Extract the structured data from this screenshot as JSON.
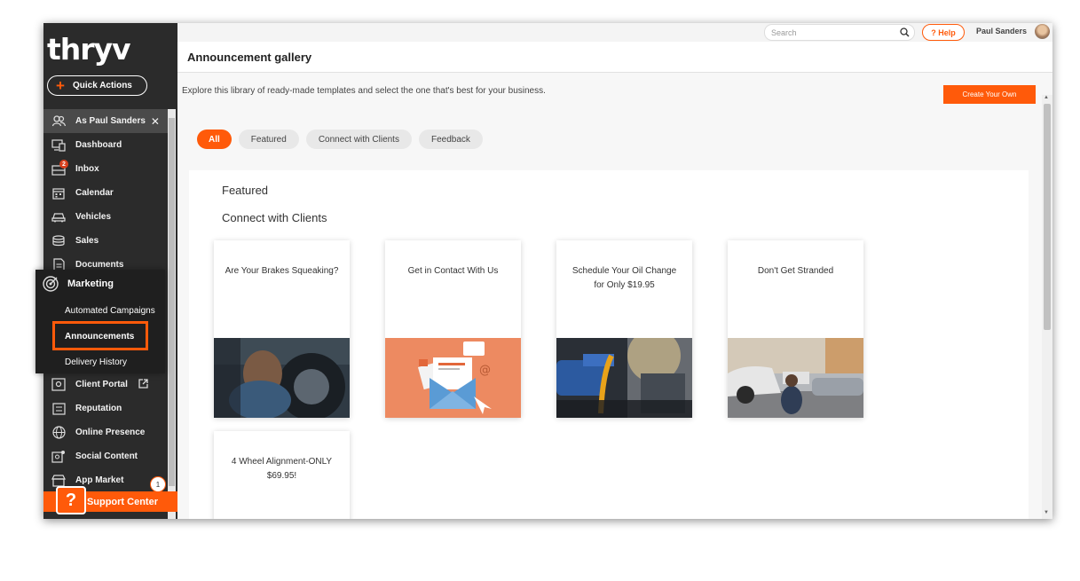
{
  "sidebar": {
    "logo": "thryv",
    "quick_actions": "Quick Actions",
    "items": [
      {
        "label": "As Paul Sanders",
        "icon": "users-icon"
      },
      {
        "label": "Dashboard",
        "icon": "dashboard-icon"
      },
      {
        "label": "Inbox",
        "icon": "inbox-icon",
        "badge": "2"
      },
      {
        "label": "Calendar",
        "icon": "calendar-icon"
      },
      {
        "label": "Vehicles",
        "icon": "vehicle-icon"
      },
      {
        "label": "Sales",
        "icon": "sales-icon"
      },
      {
        "label": "Documents",
        "icon": "documents-icon"
      },
      {
        "label": "Client Portal",
        "icon": "client-portal-icon"
      },
      {
        "label": "Reputation",
        "icon": "reputation-icon"
      },
      {
        "label": "Online Presence",
        "icon": "globe-icon"
      },
      {
        "label": "Social Content",
        "icon": "social-content-icon"
      },
      {
        "label": "App Market",
        "icon": "app-market-icon"
      }
    ],
    "marketing": {
      "label": "Marketing",
      "sub": [
        "Automated Campaigns",
        "Announcements",
        "Delivery History"
      ]
    },
    "support": "Support Center",
    "notif_count": "1"
  },
  "topbar": {
    "search_placeholder": "Search",
    "help": "Help",
    "user": "Paul Sanders"
  },
  "main": {
    "title": "Announcement gallery",
    "description": "Explore this library of ready-made templates and select the one that's best for your business.",
    "create_button": "Create Your Own",
    "filters": [
      "All",
      "Featured",
      "Connect with Clients",
      "Feedback"
    ],
    "sections": {
      "featured": "Featured",
      "connect": "Connect with Clients"
    },
    "cards": [
      {
        "title": "Are Your Brakes Squeaking?"
      },
      {
        "title": "Get in Contact With Us"
      },
      {
        "title": "Schedule Your Oil Change for Only $19.95"
      },
      {
        "title": "Don't Get Stranded"
      },
      {
        "title": "4 Wheel Alignment-ONLY $69.95!"
      }
    ]
  },
  "colors": {
    "accent": "#ff5a0a",
    "sidebar": "#2b2b2b"
  }
}
